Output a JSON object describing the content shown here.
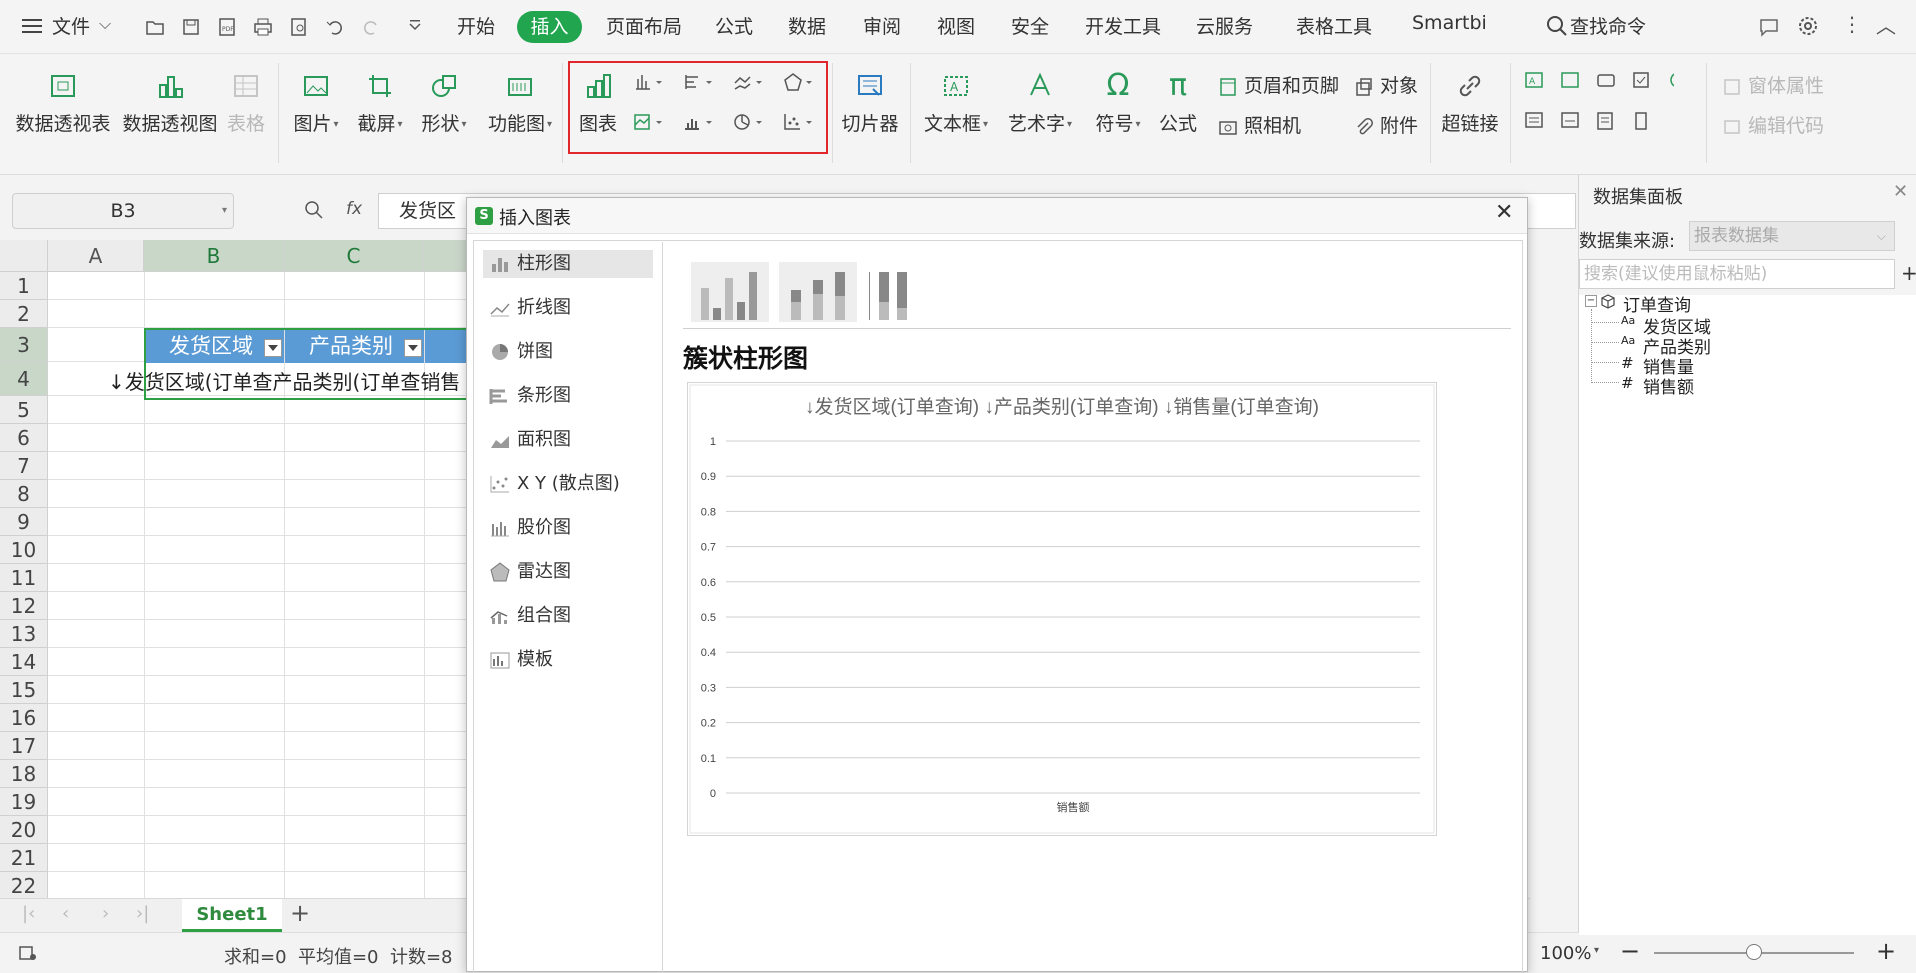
{
  "menubar": {
    "file": "文件",
    "tabs": [
      "开始",
      "插入",
      "页面布局",
      "公式",
      "数据",
      "审阅",
      "视图",
      "安全",
      "开发工具",
      "云服务",
      "表格工具",
      "Smartbi"
    ],
    "active_tab": "插入",
    "search": "查找命令"
  },
  "ribbon": {
    "pivot_table": "数据透视表",
    "pivot_chart": "数据透视图",
    "table": "表格",
    "picture": "图片",
    "screenshot": "截屏",
    "shape": "形状",
    "function_chart": "功能图",
    "chart": "图表",
    "slicer": "切片器",
    "textbox": "文本框",
    "wordart": "艺术字",
    "symbol": "符号",
    "formula": "公式",
    "header_footer": "页眉和页脚",
    "camera": "照相机",
    "object": "对象",
    "attachment": "附件",
    "hyperlink": "超链接",
    "form_props": "窗体属性",
    "edit_code": "编辑代码"
  },
  "formula_bar": {
    "name_box": "B3",
    "fx": "fx",
    "content": "发货区"
  },
  "grid": {
    "columns": [
      "A",
      "B",
      "C"
    ],
    "rows": [
      "1",
      "2",
      "3",
      "4",
      "5",
      "6",
      "7",
      "8",
      "9",
      "10",
      "11",
      "12",
      "13",
      "14",
      "15",
      "16",
      "17",
      "18",
      "19",
      "20",
      "21",
      "22"
    ],
    "b3": "发货区域",
    "c3": "产品类别",
    "row4_text": "↓发货区域(订单查产品类别(订单查销售"
  },
  "sheet": {
    "tab": "Sheet1",
    "add": "+"
  },
  "status": {
    "summary": "求和=0  平均值=0  计数=8",
    "zoom": "100%",
    "zoom_minus": "−",
    "zoom_plus": "+"
  },
  "dialog": {
    "title": "插入图表",
    "close": "✕",
    "chart_types": [
      "柱形图",
      "折线图",
      "饼图",
      "条形图",
      "面积图",
      "X Y (散点图)",
      "股价图",
      "雷达图",
      "组合图",
      "模板"
    ],
    "selected_type": "柱形图",
    "subtype_title": "簇状柱形图"
  },
  "chart_data": {
    "type": "bar",
    "title": "↓发货区域(订单查询) ↓产品类别(订单查询) ↓销售量(订单查询)",
    "categories": [
      "销售额"
    ],
    "series": [],
    "y_ticks": [
      "1",
      "0.9",
      "0.8",
      "0.7",
      "0.6",
      "0.5",
      "0.4",
      "0.3",
      "0.2",
      "0.1",
      "0"
    ],
    "ylim": [
      0,
      1
    ],
    "grid": true
  },
  "dataset_panel": {
    "title": "数据集面板",
    "source_label": "数据集来源:",
    "source_value": "报表数据集",
    "search_placeholder": "搜索(建议使用鼠标粘贴)",
    "add": "+",
    "tree_root": "订单查询",
    "fields": [
      {
        "type": "Aa",
        "name": "发货区域"
      },
      {
        "type": "Aa",
        "name": "产品类别"
      },
      {
        "type": "#",
        "name": "销售量"
      },
      {
        "type": "#",
        "name": "销售额"
      }
    ]
  }
}
